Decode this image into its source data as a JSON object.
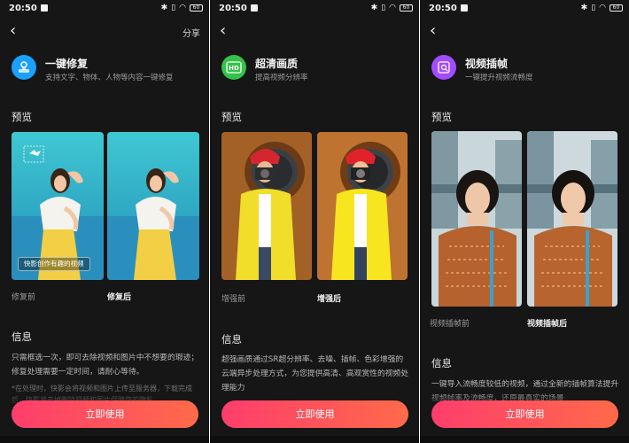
{
  "colors": {
    "background": "#161616",
    "accent_gradient_start": "#ff3e6c",
    "accent_gradient_end": "#ff6a4a",
    "icon_repair": "#1aa1ff",
    "icon_hd": "#35c24a",
    "icon_frame": "#a24bff"
  },
  "screens": [
    {
      "status": {
        "time": "20:50",
        "battery": "60"
      },
      "share_label": "分享",
      "icon": "person-stamp-icon",
      "title": "一键修复",
      "subtitle": "支持文字、物体、人物等内容一键修复",
      "preview_title": "预览",
      "watermark_text": "快影创作有趣的视频",
      "caption_before": "修复前",
      "caption_after": "修复后",
      "info_title": "信息",
      "info_text": "只需框选一次，即可去除视频和图片中不想要的瑕迹；修复处理需要一定时间，请耐心等待。",
      "info_note": "*在处理时，快影会将视频和图片上传至服务器，下载完成后，快影将去掉删除视频和图片保障您的隐私",
      "button_label": "立即使用"
    },
    {
      "status": {
        "time": "20:50",
        "battery": "60"
      },
      "icon": "hd-icon",
      "title": "超清画质",
      "subtitle": "提高视频分辨率",
      "preview_title": "预览",
      "caption_before": "增强前",
      "caption_after": "增强后",
      "info_title": "信息",
      "info_text": "超强画质通过SR超分辨率、去噪、插帧、色彩增强的云端异步处理方式，为您提供高清、高观赏性的视频处理能力",
      "button_label": "立即使用"
    },
    {
      "status": {
        "time": "20:50",
        "battery": "60"
      },
      "icon": "frame-interpolation-icon",
      "title": "视频插帧",
      "subtitle": "一键提升视频流畅度",
      "preview_title": "预览",
      "caption_before": "视频插帧前",
      "caption_after": "视频插帧后",
      "info_title": "信息",
      "info_text": "一键导入流畅度较低的视频，通过全新的插帧算法提升视频帧率及流畅度，还原最真实的场景",
      "button_label": "立即使用"
    }
  ]
}
